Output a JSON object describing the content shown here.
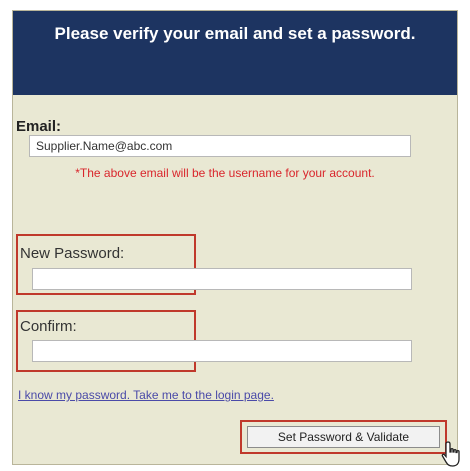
{
  "header": {
    "title": "Please verify your email and set a password."
  },
  "email": {
    "label": "Email:",
    "value": "Supplier.Name@abc.com",
    "notice": "*The above email will be the username for your account."
  },
  "new_password": {
    "label": "New Password:",
    "value": ""
  },
  "confirm": {
    "label": "Confirm:",
    "value": ""
  },
  "login_link": "I know my password. Take me to the login page.",
  "submit_button": "Set Password & Validate",
  "colors": {
    "header_bg": "#1d3461",
    "panel_bg": "#e9e8d3",
    "highlight": "#c0392b",
    "notice": "#d9262c",
    "link": "#4a4aa8"
  },
  "icons": {
    "cursor": "hand-pointer-icon"
  }
}
